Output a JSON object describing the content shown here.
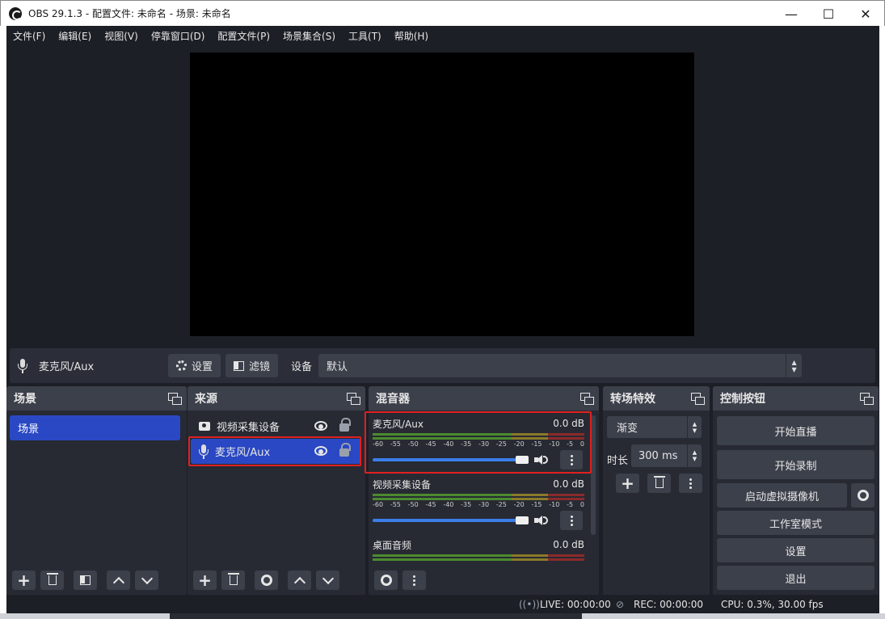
{
  "window": {
    "title": "OBS 29.1.3 - 配置文件: 未命名 - 场景: 未命名",
    "minimize": "—",
    "maximize": "☐",
    "close": "✕"
  },
  "menu": [
    "文件(F)",
    "编辑(E)",
    "视图(V)",
    "停靠窗口(D)",
    "配置文件(P)",
    "场景集合(S)",
    "工具(T)",
    "帮助(H)"
  ],
  "source_toolbar": {
    "source_name": "麦克风/Aux",
    "settings_label": "设置",
    "filters_label": "滤镜",
    "device_label": "设备",
    "device_value": "默认"
  },
  "docks": {
    "scenes": {
      "title": "场景",
      "items": [
        "场景"
      ]
    },
    "sources": {
      "title": "来源",
      "items": [
        "视频采集设备",
        "麦克风/Aux"
      ]
    },
    "mixer": {
      "title": "混音器",
      "scale": [
        "-60",
        "-55",
        "-50",
        "-45",
        "-40",
        "-35",
        "-30",
        "-25",
        "-20",
        "-15",
        "-10",
        "-5",
        "0"
      ],
      "channels": [
        {
          "name": "麦克风/Aux",
          "db": "0.0 dB",
          "volume": 1.0
        },
        {
          "name": "视频采集设备",
          "db": "0.0 dB",
          "volume": 1.0
        },
        {
          "name": "桌面音频",
          "db": "0.0 dB",
          "volume": 1.0
        }
      ]
    },
    "transitions": {
      "title": "转场特效",
      "selected": "渐变",
      "duration_label": "时长",
      "duration_value": "300 ms"
    },
    "controls": {
      "title": "控制按钮",
      "start_stream": "开始直播",
      "start_record": "开始录制",
      "virtual_cam": "启动虚拟摄像机",
      "studio_mode": "工作室模式",
      "settings": "设置",
      "exit": "退出"
    }
  },
  "status": {
    "live": "LIVE: 00:00:00",
    "rec": "REC: 00:00:00",
    "cpu": "CPU: 0.3%, 30.00 fps"
  },
  "colors": {
    "accent": "#2a48c4",
    "highlight_box": "#e02020",
    "slider": "#3b7ee8"
  }
}
